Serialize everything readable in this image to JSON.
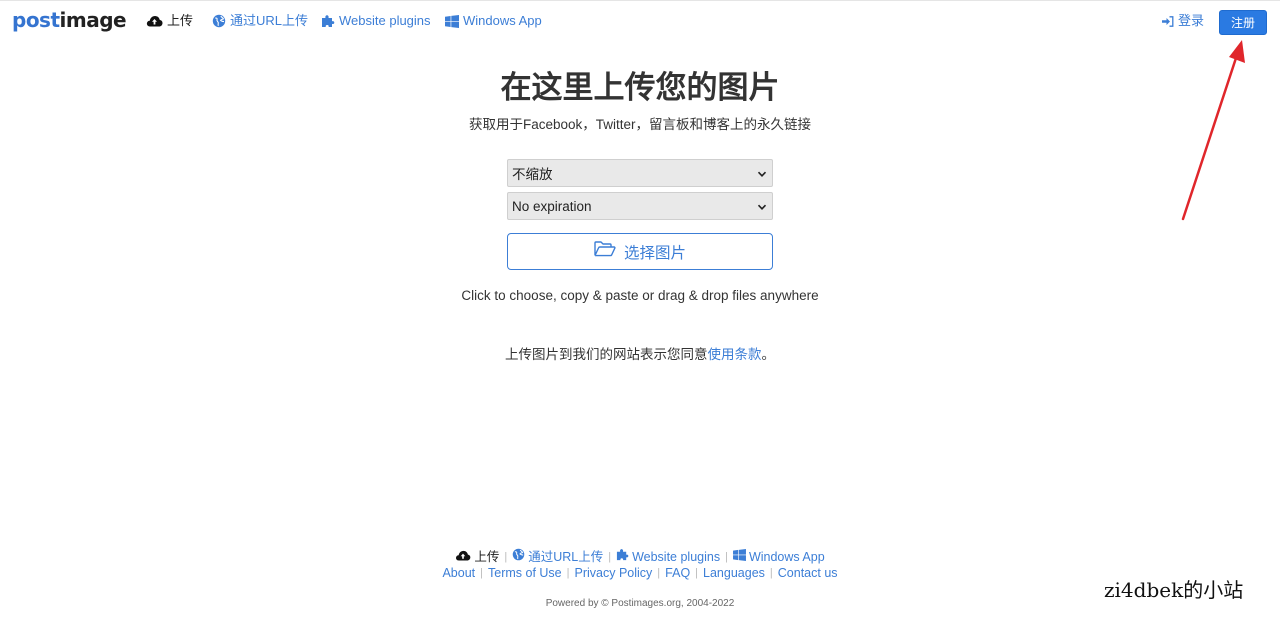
{
  "header": {
    "logo_post": "post",
    "logo_image": "image",
    "nav": {
      "upload": "上传",
      "url_upload": "通过URL上传",
      "plugins": "Website plugins",
      "windows": "Windows App"
    },
    "login": "登录",
    "signup": "注册"
  },
  "main": {
    "title": "在这里上传您的图片",
    "subtitle": "获取用于Facebook，Twitter，留言板和博客上的永久链接",
    "resize_select": "不缩放",
    "expiration_select": "No expiration",
    "choose_button": "选择图片",
    "hint": "Click to choose, copy & paste or drag & drop files anywhere",
    "terms_prefix": "上传图片到我们的网站表示您同意",
    "terms_link": "使用条款",
    "terms_suffix": "。"
  },
  "footer": {
    "upload": "上传",
    "url_upload": "通过URL上传",
    "plugins": "Website plugins",
    "windows": "Windows App",
    "links": [
      "About",
      "Terms of Use",
      "Privacy Policy",
      "FAQ",
      "Languages",
      "Contact us"
    ],
    "powered": "Powered by © Postimages.org, 2004-2022"
  },
  "watermark": "zi4dbek的小站",
  "colors": {
    "accent": "#3c7ed6",
    "signup_bg": "#2a7ae2",
    "arrow": "#e0262b"
  },
  "icons": {
    "upload": "cloud-upload-icon",
    "url": "globe-icon",
    "plugins": "puzzle-icon",
    "windows": "windows-logo-icon",
    "login": "sign-in-icon",
    "choose": "folder-open-icon"
  }
}
